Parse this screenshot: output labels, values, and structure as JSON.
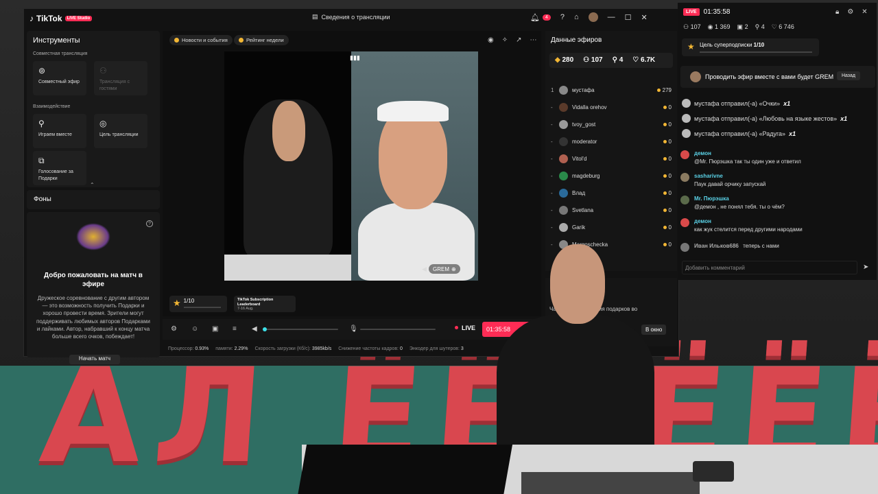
{
  "app": {
    "brand": "TikTok",
    "badge": "LIVE Studio",
    "stream_info": "Сведения о трансляции",
    "notifications": "4"
  },
  "left": {
    "title": "Инструменты",
    "group1": "Совместная трансляция",
    "tool_cohost": "Совместный эфир",
    "tool_guests": "Трансляция с гостями",
    "group2": "Взаимодействие",
    "tool_play": "Играем вместе",
    "tool_goal": "Цель трансляции",
    "tool_vote": "Голосование за Подарки",
    "backgrounds": "Фоны",
    "match_title": "Добро пожаловать на матч в эфире",
    "match_text": "Дружеское соревнование с другим автором — это возможность получить Подарки и хорошо провести время. Зрители могут поддерживать любимых авторов Подарками и лайками. Автор, набравший к концу матча больше всего очков, побеждает!",
    "match_button": "Начать матч"
  },
  "center": {
    "chip1": "Новости и события",
    "chip2": "Рейтинг недели",
    "guest_name": "GREM",
    "goal": "1/10",
    "leaderboard_title": "TikTok Subscription Leaderboard",
    "leaderboard_sub": "7-16 Aug."
  },
  "controls": {
    "live": "LIVE",
    "timer": "01:35:58"
  },
  "stats": {
    "cpu_label": "Процессор:",
    "cpu": "0.93%",
    "mem_label": "памяти:",
    "mem": "2.29%",
    "upload_label": "Скорость загрузки (Кб/с):",
    "upload": "3985kb/s",
    "fps_label": "Снижение частоты кадров:",
    "fps": "0",
    "enc_label": "Энкодер для шутеров:",
    "enc": "3"
  },
  "right": {
    "title": "Данные эфиров",
    "coins": "280",
    "viewers": "107",
    "joined": "4",
    "likes": "6.7K",
    "ranks": [
      {
        "n": "1",
        "name": "мустафа",
        "coins": "279",
        "color": "#888"
      },
      {
        "n": "-",
        "name": "Vidalla orehov",
        "coins": "0",
        "color": "#5a3a2a"
      },
      {
        "n": "-",
        "name": "tvoy_gost",
        "coins": "0",
        "color": "#999"
      },
      {
        "n": "-",
        "name": "moderator",
        "coins": "0",
        "color": "#333"
      },
      {
        "n": "-",
        "name": "Vitol'd",
        "coins": "0",
        "color": "#b06050"
      },
      {
        "n": "-",
        "name": "magdeburg",
        "coins": "0",
        "color": "#2a8a4a"
      },
      {
        "n": "-",
        "name": "Влад",
        "coins": "0",
        "color": "#2a6a9a"
      },
      {
        "n": "-",
        "name": "Svetlana",
        "coins": "0",
        "color": "#777"
      },
      {
        "n": "-",
        "name": "Garik",
        "coins": "0",
        "color": "#aaa"
      },
      {
        "n": "-",
        "name": "Margoschecka",
        "coins": "0",
        "color": "#888"
      }
    ],
    "popup_text": "Частота отображения подарков во всплывающем окне",
    "popup_button": "В окно"
  },
  "chat": {
    "live": "LIVE",
    "time": "01:35:58",
    "viewers": "107",
    "views": "1 369",
    "gifts": "2",
    "joined": "4",
    "likes": "6 746",
    "sub_goal": "Цель суперподписки",
    "sub_goal_value": "1/10",
    "cohost": "Проводить эфир вместе с вами будет GREM",
    "back": "Назад",
    "gifts_list": [
      {
        "text": "мустафа отправил(-а) «Очки»",
        "x": "x1"
      },
      {
        "text": "мустафа отправил(-а) «Любовь на языке жестов»",
        "x": "x1"
      },
      {
        "text": "мустафа отправил(-а) «Радуга»",
        "x": "x1"
      }
    ],
    "messages": [
      {
        "user": "демон",
        "text": "@Mr. Пюрэшка так ты один уже и ответил",
        "color": "#d94a4a"
      },
      {
        "user": "sasharivne",
        "text": "Паук давай орчику запускай",
        "color": "#8a7a60"
      },
      {
        "user": "Mr. Пюрэшка",
        "text": "@демон , не понял тебя. ты о чём?",
        "color": "#5a6a4a"
      },
      {
        "user": "демон",
        "text": "как жук стелится перед другими народами",
        "color": "#d94a4a"
      },
      {
        "user": "Иван Ильков686",
        "text": "теперь с нами",
        "color": "#777"
      }
    ],
    "compose_placeholder": "Добавить комментарий"
  },
  "banner": {
    "text": "АЛ ЁЁЁЁЁЁ!"
  },
  "colors": {
    "accent": "#fe2c55",
    "banner": "#2f6e63",
    "banner_text": "#d9474f"
  }
}
